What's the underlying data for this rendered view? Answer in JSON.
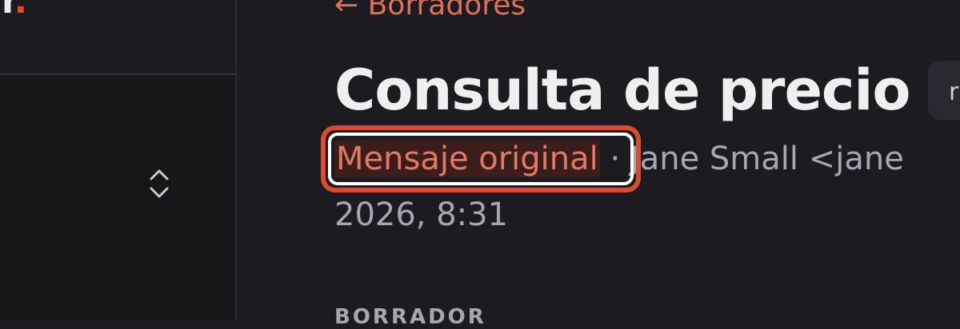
{
  "sidebar": {
    "logo_letter": "r",
    "logo_dot": "."
  },
  "header": {
    "back_link": "← Borradores",
    "title": "Consulta de precio",
    "tag": "r"
  },
  "message": {
    "original_link": "Mensaje original",
    "sender": " · Jane Small <jane",
    "date": "2026, 8:31"
  },
  "section": {
    "label": "BORRADOR"
  },
  "colors": {
    "accent": "#e0705a",
    "highlight": "#dd4a2e",
    "background": "#1c1b20"
  }
}
